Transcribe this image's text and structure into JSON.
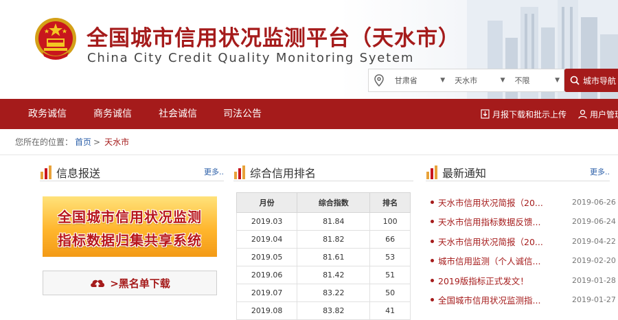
{
  "header": {
    "title": "全国城市信用状况监测平台（天水市）",
    "subtitle": "China City Credit Quality Monitoring Syetem",
    "region": {
      "province": "甘肃省",
      "city": "天水市",
      "county": "不限"
    },
    "city_nav_label": "城市导航"
  },
  "nav": {
    "items": [
      "政务诚信",
      "商务诚信",
      "社会诚信",
      "司法公告"
    ],
    "report_download": "月报下载和批示上传",
    "user_manage": "用户管理"
  },
  "breadcrumb": {
    "prefix": "您所在的位置：",
    "home": "首页",
    "sep": ">",
    "current": "天水市"
  },
  "left_panel": {
    "title": "信息报送",
    "more": "更多..",
    "banner_line1": "全国城市信用状况监测",
    "banner_line2": "指标数据归集共享系统",
    "blacklist_label": ">黑名单下载"
  },
  "ranking_panel": {
    "title": "综合信用排名",
    "columns": [
      "月份",
      "综合指数",
      "排名"
    ],
    "rows": [
      [
        "2019.03",
        "81.84",
        "100"
      ],
      [
        "2019.04",
        "81.82",
        "66"
      ],
      [
        "2019.05",
        "81.61",
        "53"
      ],
      [
        "2019.06",
        "81.42",
        "51"
      ],
      [
        "2019.07",
        "83.22",
        "50"
      ],
      [
        "2019.08",
        "83.82",
        "41"
      ]
    ]
  },
  "notice_panel": {
    "title": "最新通知",
    "more": "更多..",
    "items": [
      {
        "text": "天水市信用状况简报（20...",
        "date": "2019-06-26"
      },
      {
        "text": "天水市信用指标数据反馈...",
        "date": "2019-06-24"
      },
      {
        "text": "天水市信用状况简报（20...",
        "date": "2019-04-22"
      },
      {
        "text": "城市信用监测（个人诚信...",
        "date": "2019-02-20"
      },
      {
        "text": "2019版指标正式发文！",
        "date": "2019-01-28"
      },
      {
        "text": "全国城市信用状况监测指...",
        "date": "2019-01-27"
      }
    ]
  },
  "colors": {
    "brand_red": "#a51b1b",
    "link_blue": "#2a5ea8"
  }
}
